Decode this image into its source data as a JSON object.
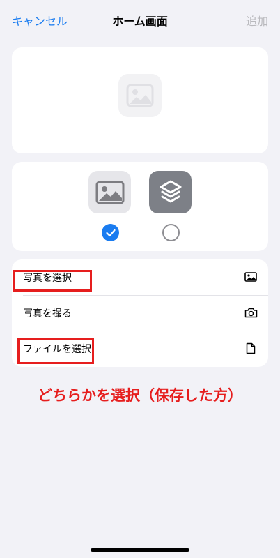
{
  "nav": {
    "cancel_label": "キャンセル",
    "title": "ホーム画面",
    "add_label": "追加"
  },
  "preview": {
    "icon": "image-placeholder-icon"
  },
  "choices": [
    {
      "icon": "photo-icon",
      "selected": true
    },
    {
      "icon": "shortcuts-icon",
      "selected": false
    }
  ],
  "actions": [
    {
      "label": "写真を選択",
      "icon": "photo-icon"
    },
    {
      "label": "写真を撮る",
      "icon": "camera-icon"
    },
    {
      "label": "ファイルを選択",
      "icon": "document-icon"
    }
  ],
  "annotation": {
    "text": "どちらかを選択（保存した方）"
  },
  "colors": {
    "accent": "#1a7cf0",
    "annotation": "#e61e1e",
    "disabled": "#b9b9bd",
    "background": "#f2f2f7"
  }
}
